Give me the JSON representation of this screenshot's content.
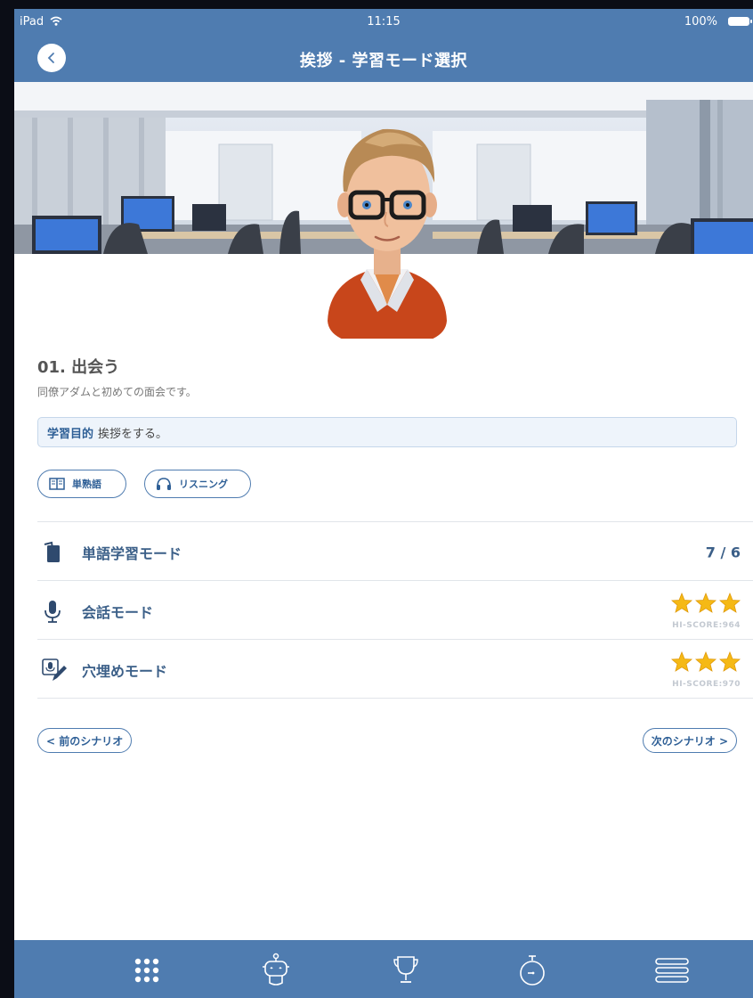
{
  "status_bar": {
    "device": "iPad",
    "time": "11:15",
    "battery": "100%"
  },
  "header": {
    "title": "挨拶 - 学習モード選択"
  },
  "scenario": {
    "title": "01. 出会う",
    "description": "同僚アダムと初めての面会です。",
    "goal_label": "学習目的",
    "goal_text": "挨拶をする。"
  },
  "tags": [
    {
      "label": "単熟語",
      "icon": "book-icon"
    },
    {
      "label": "リスニング",
      "icon": "headphones-icon"
    }
  ],
  "modes": [
    {
      "label": "単語学習モード",
      "icon": "cards-icon",
      "count": "7 / 6"
    },
    {
      "label": "会話モード",
      "icon": "microphone-icon",
      "stars": 3,
      "hiscore": "HI-SCORE:964"
    },
    {
      "label": "穴埋めモード",
      "icon": "fill-in-icon",
      "stars": 3,
      "hiscore": "HI-SCORE:970"
    }
  ],
  "navigation": {
    "prev_label": "< 前のシナリオ",
    "next_label": "次のシナリオ >"
  },
  "tabbar": [
    {
      "name": "grid-icon"
    },
    {
      "name": "robot-icon"
    },
    {
      "name": "trophy-icon"
    },
    {
      "name": "stopwatch-icon"
    },
    {
      "name": "menu-icon"
    }
  ],
  "colors": {
    "accent": "#4f7cb0",
    "text": "#3b5f88",
    "star": "#f5b915"
  }
}
